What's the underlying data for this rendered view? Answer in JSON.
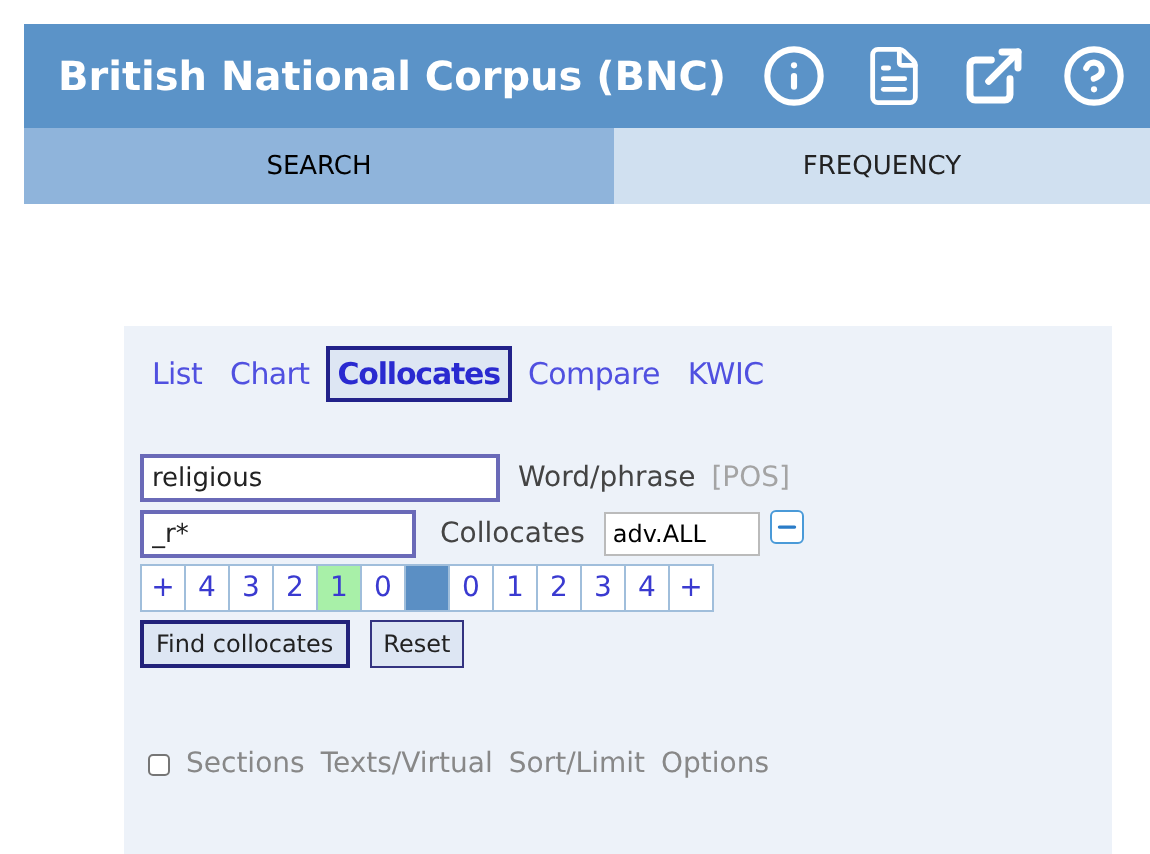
{
  "header": {
    "title": "British National Corpus (BNC)"
  },
  "tabs": [
    {
      "label": "SEARCH",
      "selected": true
    },
    {
      "label": "FREQUENCY",
      "selected": false
    }
  ],
  "modes": [
    {
      "label": "List",
      "selected": false
    },
    {
      "label": "Chart",
      "selected": false
    },
    {
      "label": "Collocates",
      "selected": true
    },
    {
      "label": "Compare",
      "selected": false
    },
    {
      "label": "KWIC",
      "selected": false
    }
  ],
  "word_field": {
    "value": "religious",
    "label": "Word/phrase",
    "pos_link": "[POS]"
  },
  "collocate_field": {
    "value": "_r*",
    "label": "Collocates",
    "pos_value": "adv.ALL"
  },
  "span": [
    {
      "kind": "plus",
      "label": "+",
      "selected": false
    },
    {
      "kind": "num",
      "label": "4",
      "selected": false
    },
    {
      "kind": "num",
      "label": "3",
      "selected": false
    },
    {
      "kind": "num",
      "label": "2",
      "selected": false
    },
    {
      "kind": "num",
      "label": "1",
      "selected": true
    },
    {
      "kind": "num",
      "label": "0",
      "selected": false
    },
    {
      "kind": "node",
      "selected": true
    },
    {
      "kind": "num",
      "label": "0",
      "selected": false
    },
    {
      "kind": "num",
      "label": "1",
      "selected": false
    },
    {
      "kind": "num",
      "label": "2",
      "selected": false
    },
    {
      "kind": "num",
      "label": "3",
      "selected": false
    },
    {
      "kind": "num",
      "label": "4",
      "selected": false
    },
    {
      "kind": "plus",
      "label": "+",
      "selected": false
    }
  ],
  "buttons": [
    "Find collocates",
    "Reset"
  ],
  "options": {
    "sections_checked": false,
    "links": [
      "Sections",
      "Texts/Virtual",
      "Sort/Limit",
      "Options"
    ]
  }
}
